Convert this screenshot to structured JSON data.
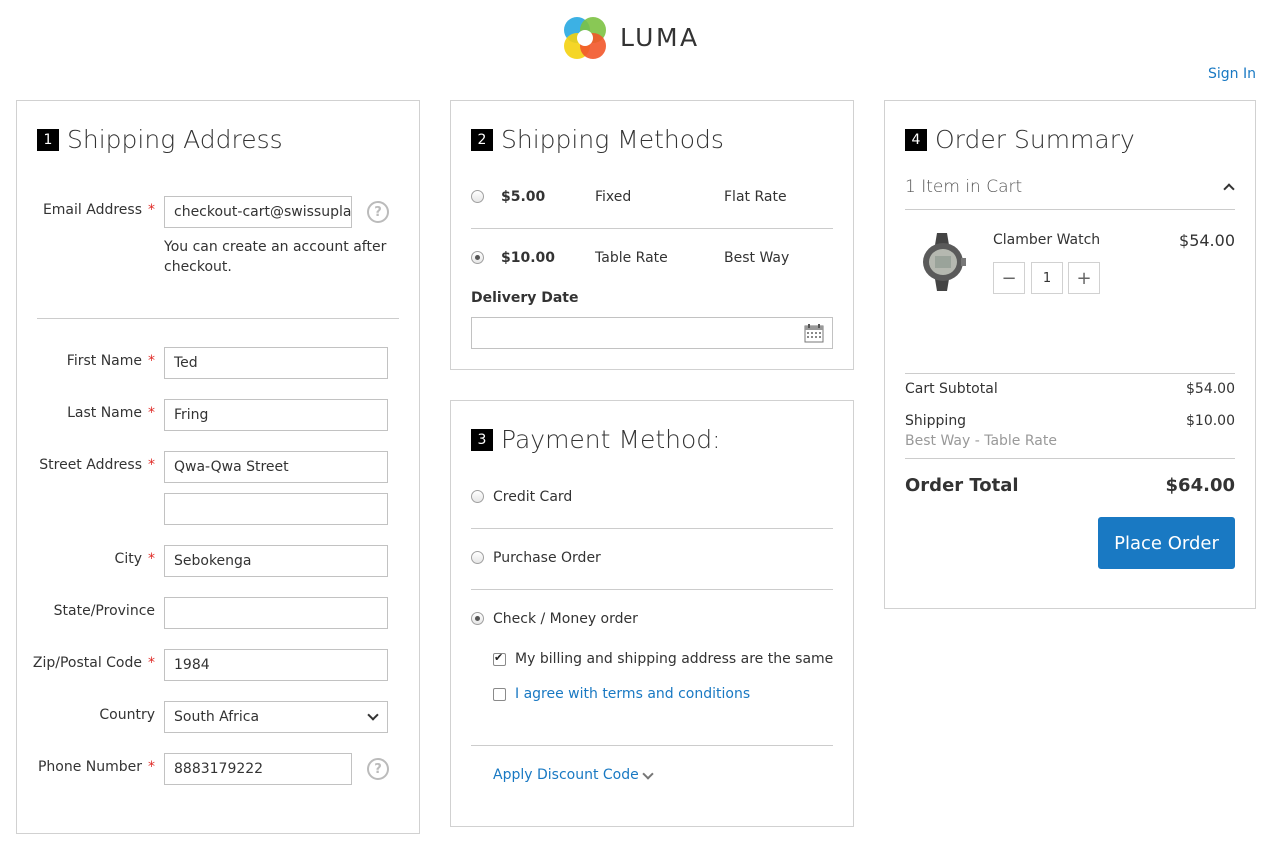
{
  "header": {
    "logo_text": "LUMA",
    "sign_in": "Sign In"
  },
  "shipping_address": {
    "step": "1",
    "title": "Shipping Address",
    "email_label": "Email Address",
    "email_value": "checkout-cart@swissuplab",
    "email_note_line1": "You can create an account after",
    "email_note_line2": "checkout.",
    "required_mark": "*",
    "help_mark": "?",
    "first_name_label": "First Name",
    "first_name_value": "Ted",
    "last_name_label": "Last Name",
    "last_name_value": "Fring",
    "street_label": "Street Address",
    "street_value": "Qwa-Qwa Street",
    "street2_value": "",
    "city_label": "City",
    "city_value": "Sebokenga",
    "state_label": "State/Province",
    "state_value": "",
    "zip_label": "Zip/Postal Code",
    "zip_value": "1984",
    "country_label": "Country",
    "country_value": "South Africa",
    "phone_label": "Phone Number",
    "phone_value": "8883179222"
  },
  "shipping_methods": {
    "step": "2",
    "title": "Shipping Methods",
    "options": [
      {
        "price": "$5.00",
        "method": "Fixed",
        "carrier": "Flat Rate",
        "selected": false
      },
      {
        "price": "$10.00",
        "method": "Table Rate",
        "carrier": "Best Way",
        "selected": true
      }
    ],
    "delivery_date_label": "Delivery Date",
    "delivery_date_value": ""
  },
  "payment_method": {
    "step": "3",
    "title": "Payment Method:",
    "options": [
      {
        "label": "Credit Card",
        "selected": false
      },
      {
        "label": "Purchase Order",
        "selected": false
      },
      {
        "label": "Check / Money order",
        "selected": true
      }
    ],
    "billing_same_label": "My billing and shipping address are the same",
    "billing_same_checked": true,
    "terms_label": "I agree with terms and conditions",
    "terms_checked": false,
    "discount_link": "Apply Discount Code"
  },
  "order_summary": {
    "step": "4",
    "title": "Order Summary",
    "items_in_cart": "1 Item in Cart",
    "item": {
      "name": "Clamber Watch",
      "price": "$54.00",
      "qty": "1",
      "minus": "−",
      "plus": "+"
    },
    "subtotal_label": "Cart Subtotal",
    "subtotal_value": "$54.00",
    "shipping_label": "Shipping",
    "shipping_value": "$10.00",
    "shipping_method": "Best Way - Table Rate",
    "total_label": "Order Total",
    "total_value": "$64.00",
    "place_order": "Place Order"
  },
  "colors": {
    "accent": "#1979c3",
    "required": "#e02b27",
    "border": "#d1d1d1"
  }
}
